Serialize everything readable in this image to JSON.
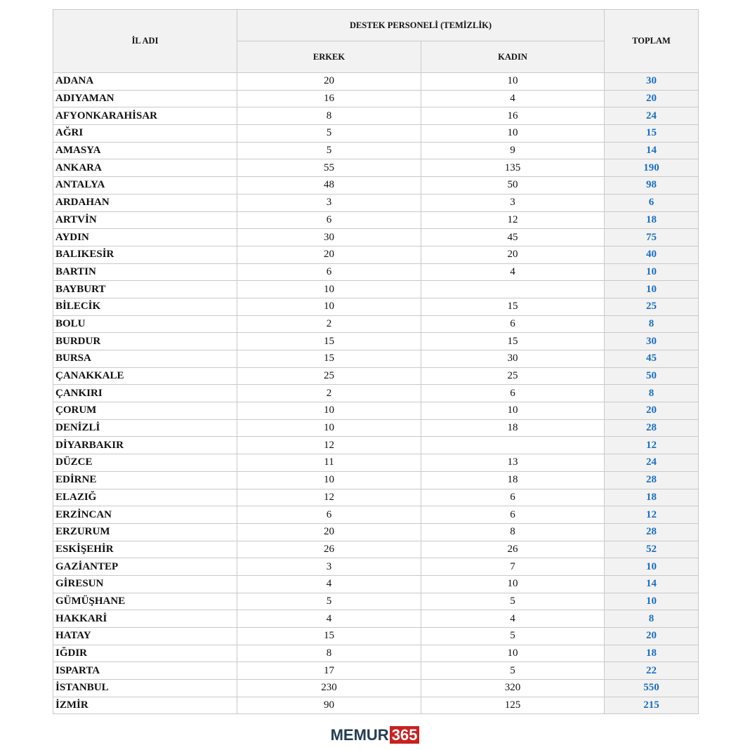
{
  "table": {
    "headers": {
      "il_adi": "İL ADI",
      "group": "DESTEK PERSONELİ (TEMİZLİK)",
      "erkek": "ERKEK",
      "kadin": "KADIN",
      "toplam": "TOPLAM"
    },
    "rows": [
      {
        "il": "ADANA",
        "erkek": "20",
        "kadin": "10",
        "toplam": "30"
      },
      {
        "il": "ADIYAMAN",
        "erkek": "16",
        "kadin": "4",
        "toplam": "20"
      },
      {
        "il": "AFYONKARAHİSAR",
        "erkek": "8",
        "kadin": "16",
        "toplam": "24"
      },
      {
        "il": "AĞRI",
        "erkek": "5",
        "kadin": "10",
        "toplam": "15"
      },
      {
        "il": "AMASYA",
        "erkek": "5",
        "kadin": "9",
        "toplam": "14"
      },
      {
        "il": "ANKARA",
        "erkek": "55",
        "kadin": "135",
        "toplam": "190"
      },
      {
        "il": "ANTALYA",
        "erkek": "48",
        "kadin": "50",
        "toplam": "98"
      },
      {
        "il": "ARDAHAN",
        "erkek": "3",
        "kadin": "3",
        "toplam": "6"
      },
      {
        "il": "ARTVİN",
        "erkek": "6",
        "kadin": "12",
        "toplam": "18"
      },
      {
        "il": "AYDIN",
        "erkek": "30",
        "kadin": "45",
        "toplam": "75"
      },
      {
        "il": "BALIKESİR",
        "erkek": "20",
        "kadin": "20",
        "toplam": "40"
      },
      {
        "il": "BARTIN",
        "erkek": "6",
        "kadin": "4",
        "toplam": "10"
      },
      {
        "il": "BAYBURT",
        "erkek": "10",
        "kadin": "",
        "toplam": "10"
      },
      {
        "il": "BİLECİK",
        "erkek": "10",
        "kadin": "15",
        "toplam": "25"
      },
      {
        "il": "BOLU",
        "erkek": "2",
        "kadin": "6",
        "toplam": "8"
      },
      {
        "il": "BURDUR",
        "erkek": "15",
        "kadin": "15",
        "toplam": "30"
      },
      {
        "il": "BURSA",
        "erkek": "15",
        "kadin": "30",
        "toplam": "45"
      },
      {
        "il": "ÇANAKKALE",
        "erkek": "25",
        "kadin": "25",
        "toplam": "50"
      },
      {
        "il": "ÇANKIRI",
        "erkek": "2",
        "kadin": "6",
        "toplam": "8"
      },
      {
        "il": "ÇORUM",
        "erkek": "10",
        "kadin": "10",
        "toplam": "20"
      },
      {
        "il": "DENİZLİ",
        "erkek": "10",
        "kadin": "18",
        "toplam": "28"
      },
      {
        "il": "DİYARBAKIR",
        "erkek": "12",
        "kadin": "",
        "toplam": "12"
      },
      {
        "il": "DÜZCE",
        "erkek": "11",
        "kadin": "13",
        "toplam": "24"
      },
      {
        "il": "EDİRNE",
        "erkek": "10",
        "kadin": "18",
        "toplam": "28"
      },
      {
        "il": "ELAZIĞ",
        "erkek": "12",
        "kadin": "6",
        "toplam": "18"
      },
      {
        "il": "ERZİNCAN",
        "erkek": "6",
        "kadin": "6",
        "toplam": "12"
      },
      {
        "il": "ERZURUM",
        "erkek": "20",
        "kadin": "8",
        "toplam": "28"
      },
      {
        "il": "ESKİŞEHİR",
        "erkek": "26",
        "kadin": "26",
        "toplam": "52"
      },
      {
        "il": "GAZİANTEP",
        "erkek": "3",
        "kadin": "7",
        "toplam": "10"
      },
      {
        "il": "GİRESUN",
        "erkek": "4",
        "kadin": "10",
        "toplam": "14"
      },
      {
        "il": "GÜMÜŞHANE",
        "erkek": "5",
        "kadin": "5",
        "toplam": "10"
      },
      {
        "il": "HAKKARİ",
        "erkek": "4",
        "kadin": "4",
        "toplam": "8"
      },
      {
        "il": "HATAY",
        "erkek": "15",
        "kadin": "5",
        "toplam": "20"
      },
      {
        "il": "IĞDIR",
        "erkek": "8",
        "kadin": "10",
        "toplam": "18"
      },
      {
        "il": "ISPARTA",
        "erkek": "17",
        "kadin": "5",
        "toplam": "22"
      },
      {
        "il": "İSTANBUL",
        "erkek": "230",
        "kadin": "320",
        "toplam": "550"
      },
      {
        "il": "İZMİR",
        "erkek": "90",
        "kadin": "125",
        "toplam": "215"
      }
    ]
  },
  "footer": {
    "logo_word": "MEMUR",
    "logo_number": "365",
    "colors": {
      "word": "#243d55",
      "badge": "#c9201f"
    }
  },
  "colors": {
    "total_text": "#1a6fc2",
    "header_bg": "#f2f2f2",
    "border": "#c9c9c9"
  }
}
